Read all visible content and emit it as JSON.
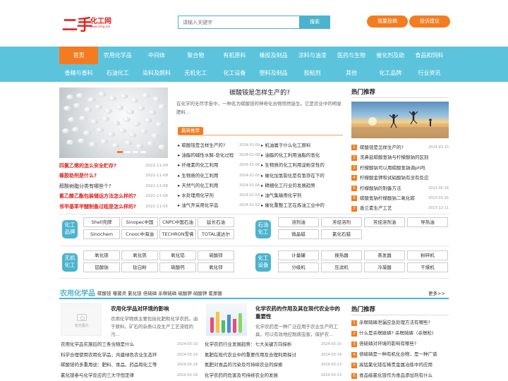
{
  "header": {
    "logo_main": "二手",
    "logo_sub": "化工网",
    "logo_url": "www.2shg.net",
    "search_placeholder": "请输入关键字",
    "search_button": "搜索",
    "btn_submit": "我要投稿",
    "btn_suggest": "投诉建议"
  },
  "nav": {
    "row1": [
      "首页",
      "农用化学品",
      "中间体",
      "聚合物",
      "有机原料",
      "橡胶及制品",
      "涂料与油漆",
      "医药与生物",
      "催化剂及助",
      "食品和饲料"
    ],
    "row2": [
      "香精与香料",
      "石油化工",
      "染料及颜料",
      "无机化工",
      "化工设备",
      "塑料及制品",
      "胶粘剂",
      "其他",
      "化工品牌",
      "行业资讯"
    ]
  },
  "left_list": [
    {
      "title": "四氯乙烯的怎么安全贮存?",
      "date": "2022-11-09",
      "red": true
    },
    {
      "title": "橡胶助剂是什么?",
      "date": "2022-11-08",
      "red": true
    },
    {
      "title": "醇酸树脂分类有哪些个?",
      "date": "2022-11-08",
      "red": false
    },
    {
      "title": "氯乙酸乙酯包装储运方法怎么样的?",
      "date": "2022-11-06",
      "red": true
    },
    {
      "title": "邻甲基苯甲醚制备过程是怎么样的?",
      "date": "2022-11-05",
      "red": true
    }
  ],
  "featured": {
    "title": "碳酸铵是怎样生产的?",
    "desc": "在化学的无尽宇宙中，一种名为碳酸铵的神奇化合物悄然诞生。它是农业中的明星肥料..."
  },
  "latest": {
    "badge": "最新推荐",
    "col1": [
      {
        "t": "碳酸铵是怎样生产的?",
        "d": "2024-01-09"
      },
      {
        "t": "油脂的碱性水解-皂化过程",
        "d": "2024-01-08"
      },
      {
        "t": "纤维素的化工利用",
        "d": "2024-01-06"
      },
      {
        "t": "生物质的化工利用",
        "d": "2024-01-05"
      },
      {
        "t": "天然气的化工利用",
        "d": "2024-01-04"
      },
      {
        "t": "水处理用化学剂",
        "d": "2024-01-03"
      },
      {
        "t": "油气开采用化学品",
        "d": "2024-01-02"
      }
    ],
    "col2": [
      {
        "t": "机油属于什么化工原料"
      },
      {
        "t": "油脂的化工利用油脂的氢化"
      },
      {
        "t": "生物质的化工利用淀粉变性的"
      },
      {
        "t": "催化加氢裂化是有氢存在下的"
      },
      {
        "t": "精细化工行业的发展趋势"
      },
      {
        "t": "油气集输用化学剂"
      },
      {
        "t": "催化重整工艺在炼油工业中的"
      }
    ]
  },
  "hot": {
    "title": "热门推荐",
    "items": [
      {
        "n": "1",
        "t": "碳酸铵是怎样生产的?",
        "d": "2024-03-15"
      },
      {
        "n": "2",
        "t": "洗鼻盐碳酸氢钠与柠檬酸钠的区别",
        "d": ""
      },
      {
        "n": "3",
        "t": "柠檬酸钠可以用碳酸氢钠调ph吗",
        "d": ""
      },
      {
        "n": "4",
        "t": "柠檬酸金钾和试硝酸钠有没有反应",
        "d": ""
      },
      {
        "n": "5",
        "t": "柠檬酸钠的制备方法",
        "d": "2023-05-16"
      },
      {
        "n": "6",
        "t": "碳酸氢钠柠檬酸钠二氧化碳",
        "d": "2023-03-25"
      },
      {
        "n": "7",
        "t": "香兰素生产工艺",
        "d": "2023-12-11"
      }
    ]
  },
  "brands": {
    "badge": "化工品牌",
    "items": [
      "Shell壳牌",
      "Sinopec中国",
      "CNPC中国石油",
      "延长石油",
      "Sinochem",
      "Cnooc中海油",
      "TECHRON雪佛",
      "TOTAL道达尔"
    ]
  },
  "petro": {
    "badge": "石油化工",
    "items": [
      "溶剂油",
      "芳烃溶剂",
      "芳烃溶剂油",
      "导热油",
      "微晶蜡",
      "氯化石蜡"
    ]
  },
  "inorganic": {
    "badge": "无机化工",
    "items": [
      "氧化镁",
      "氧化铁",
      "氧化铝",
      "硫酸锌",
      "铝酸钠",
      "钛白粉",
      "硫酸钙",
      "氧化锌"
    ]
  },
  "equipment": {
    "badge": "化工设备",
    "items": [
      "计量罐",
      "换热器",
      "蒸发器",
      "粉碎机",
      "分级机",
      "压滤机",
      "冷凝器",
      "干燥机"
    ]
  },
  "section": {
    "title": "农用化学品",
    "tags": "碳酸铵 噻菌灵 氯化铵 倍硫磷 杀螟硫磷 硫酸钾 硝酸钾 氰尿酸",
    "more": "更多>>",
    "no_image": "暂无图片",
    "article1_title": "农用化学品对环境的影响",
    "article1_desc": "农用化学物质主要包括化肥和化学农药。由于原料、矿石的杂质以及生产工艺流程的污...",
    "article2_title": "化学农药的作用及其在现代农业中的重要性",
    "article2_desc": "化学农药是一种广泛应用于农业生产的工具，可以有效地控制病虫害，保护农..."
  },
  "bottom_col1": [
    {
      "t": "农用化学品实施后的三条含随是什么",
      "d": "2024-03-19"
    },
    {
      "t": "科学合理使用农用化学品，共建绿色农业生态环",
      "d": "2024-03-19"
    },
    {
      "t": "碳酸铵的多重用途：肥料、食品、药品和化工等",
      "d": "2024-03-18"
    },
    {
      "t": "氯化铵参与化学反应的三大守恒定律",
      "d": "2024-03-18"
    }
  ],
  "bottom_col2": [
    {
      "t": "化学农药行业发展趋势：七大关键方向探析",
      "d": "2024-03-15"
    },
    {
      "t": "氮肥在现代农业中的重要作用及合理利用探讨",
      "d": "2024-03-14"
    },
    {
      "t": "氮肥对食品的污染及可持续农业的探索",
      "d": "2024-03-13"
    },
    {
      "t": "化学农药的危害及可持续农业的发展",
      "d": "2024-03-13"
    }
  ],
  "hot2": {
    "title": "热门推荐",
    "items": [
      {
        "n": "1",
        "t": "杀螟硫磷泄漏应急处理方法有哪些?"
      },
      {
        "n": "2",
        "t": "什么是杀螟硫磷? 杀螟硫磷（杀螟松)"
      },
      {
        "n": "3",
        "t": "倍硫磷对环境的影响有哪些?"
      },
      {
        "n": "4",
        "t": "倍硫磷是一种有机化合物，是一种广谱"
      },
      {
        "n": "5",
        "t": "高锰氯化铵在稀贵金属冶炼中的应用"
      },
      {
        "n": "6",
        "t": "食品级氯化铵作为食品添加剂有什么"
      }
    ]
  },
  "colors": {
    "accent": "#f47c20",
    "nav": "#5bc4dc",
    "primary": "#4bb3cd",
    "red": "#e2211c"
  }
}
